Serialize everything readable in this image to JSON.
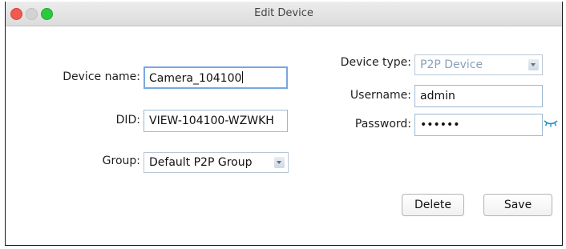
{
  "window": {
    "title": "Edit Device"
  },
  "form": {
    "device_name_label": "Device name:",
    "device_name_value": "Camera_104100",
    "did_label": "DID:",
    "did_value": "VIEW-104100-WZWKH",
    "group_label": "Group:",
    "group_value": "Default P2P Group",
    "device_type_label": "Device type:",
    "device_type_value": "P2P Device",
    "username_label": "Username:",
    "username_value": "admin",
    "password_label": "Password:",
    "password_value": "••••••"
  },
  "buttons": {
    "delete_label": "Delete",
    "save_label": "Save"
  },
  "colors": {
    "accent": "#1e90c8",
    "focus_ring": "#79a7e0"
  },
  "icons": {
    "password_toggle": "eye-closed-icon"
  }
}
